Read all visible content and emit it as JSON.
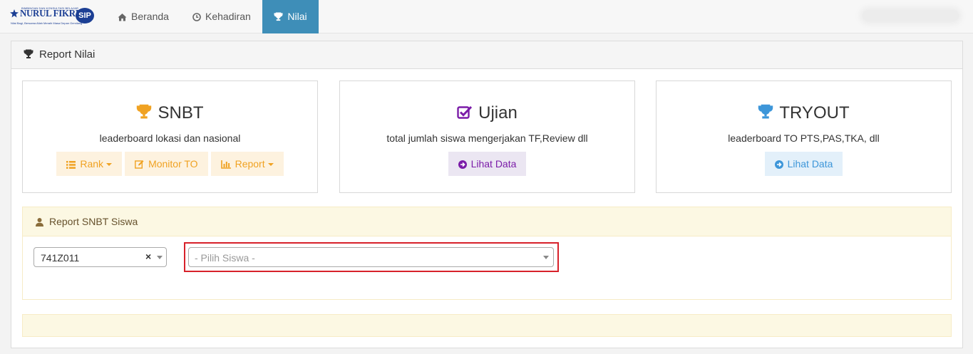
{
  "brand": {
    "top_line": "BIMBINGAN DAN KONSULTASI BELAJAR",
    "name": "NURUL FIKRI",
    "badge": "SIP",
    "tagline": "Nilai Bagi, Bersama Allah Meraih Masa Depan Gemilang"
  },
  "nav": {
    "items": [
      {
        "label": "Beranda",
        "icon": "home-icon"
      },
      {
        "label": "Kehadiran",
        "icon": "clock-icon"
      },
      {
        "label": "Nilai",
        "icon": "trophy-icon",
        "active": true
      }
    ],
    "active_color": "#3e8eb8"
  },
  "panel": {
    "title": "Report Nilai"
  },
  "cards": {
    "snbt": {
      "title": "SNBT",
      "subtitle": "leaderboard lokasi dan nasional",
      "icon": "trophy-icon",
      "icon_color": "#f0a222",
      "buttons": {
        "rank": "Rank",
        "monitor": "Monitor TO",
        "report": "Report"
      }
    },
    "ujian": {
      "title": "Ujian",
      "subtitle": "total jumlah siswa mengerjakan TF,Review dll",
      "icon": "check-square-icon",
      "icon_color": "#7b1ca8",
      "button": "Lihat Data"
    },
    "tryout": {
      "title": "TRYOUT",
      "subtitle": "leaderboard TO PTS,PAS,TKA, dll",
      "icon": "trophy-icon",
      "icon_color": "#3d96d9",
      "button": "Lihat Data"
    }
  },
  "report_snbt": {
    "title": "Report SNBT Siswa",
    "icon": "user-icon",
    "class_select": {
      "value": "741Z011",
      "clear": "×"
    },
    "student_select": {
      "placeholder": "- Pilih Siswa -"
    }
  },
  "colors": {
    "highlight": "#d7212a",
    "warning_bg": "#fcf8e3"
  }
}
